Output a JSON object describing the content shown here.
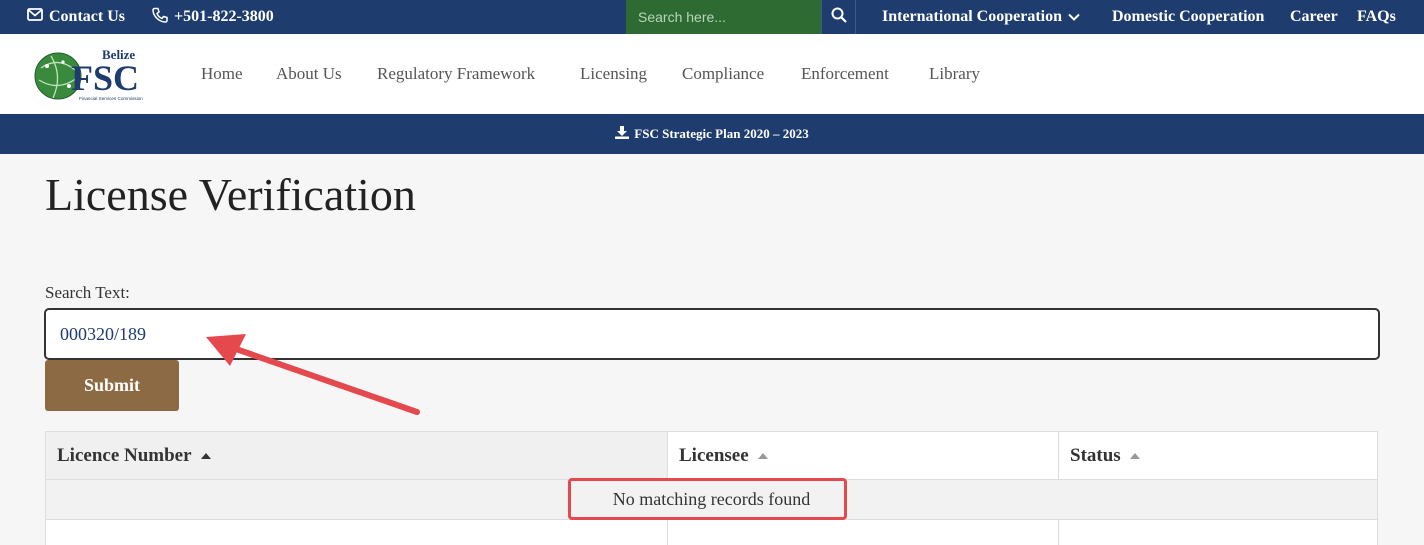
{
  "topbar": {
    "contact_label": "Contact Us",
    "phone": "+501-822-3800",
    "search_placeholder": "Search here...",
    "nav": [
      "International Cooperation",
      "Domestic Cooperation",
      "Career",
      "FAQs"
    ]
  },
  "logo": {
    "word_top": "Belize",
    "word_main": "FSC",
    "subtitle": "Financial Services Commission"
  },
  "mainnav": [
    "Home",
    "About Us",
    "Regulatory Framework",
    "Licensing",
    "Compliance",
    "Enforcement",
    "Library"
  ],
  "banner": {
    "label": "FSC Strategic Plan 2020 – 2023"
  },
  "page": {
    "title": "License Verification",
    "search_label": "Search Text:",
    "search_value": "000320/189",
    "submit_label": "Submit"
  },
  "table": {
    "columns": [
      "Licence Number",
      "Licensee",
      "Status"
    ],
    "empty_message": "No matching records found"
  },
  "colors": {
    "navy": "#1f3c6e",
    "search_green": "#2e6b33",
    "submit_brown": "#8c6b44",
    "annotation_red": "#e5484d"
  },
  "icons": {
    "contact": "envelope-icon",
    "phone": "phone-icon",
    "search": "search-icon",
    "dropdown": "chevron-down-icon",
    "download": "download-icon"
  }
}
